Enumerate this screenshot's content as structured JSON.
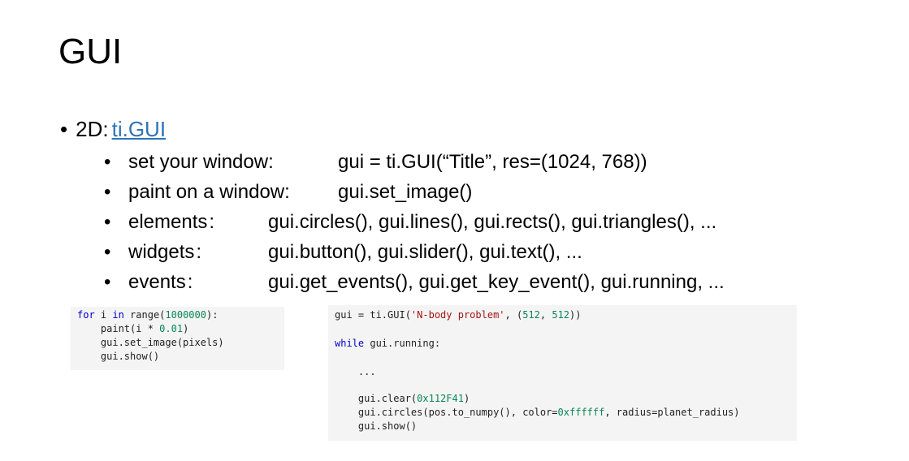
{
  "slide": {
    "title": "GUI",
    "main_bullet": {
      "prefix": "2D",
      "colon": ":",
      "link": "ti.GUI"
    },
    "items": [
      {
        "label": "set your window:",
        "value": "gui = ti.GUI(“Title”, res=(1024, 768))"
      },
      {
        "label": "paint on a window:",
        "value": "gui.set_image()"
      },
      {
        "label": "elements",
        "colon": ":",
        "value": "gui.circles(), gui.lines(), gui.rects(), gui.triangles(), ..."
      },
      {
        "label": "widgets",
        "colon": ":",
        "value": "gui.button(), gui.slider(), gui.text(), ..."
      },
      {
        "label": "events",
        "colon": ":",
        "value": "gui.get_events(), gui.get_key_event(), gui.running, ..."
      }
    ]
  },
  "code_left": {
    "l1a": "for",
    "l1b": " i ",
    "l1c": "in",
    "l1d": " range(",
    "l1e": "1000000",
    "l1f": "):",
    "l2a": "    paint(i * ",
    "l2b": "0.01",
    "l2c": ")",
    "l3": "    gui.set_image(pixels)",
    "l4": "    gui.show()"
  },
  "code_right": {
    "l1a": "gui = ti.GUI(",
    "l1b": "'N-body problem'",
    "l1c": ", (",
    "l1d": "512",
    "l1e": ", ",
    "l1f": "512",
    "l1g": "))",
    "l2a": "while",
    "l2b": " gui.running:",
    "l3": "    ...",
    "l4a": "    gui.clear(",
    "l4b": "0x112F41",
    "l4c": ")",
    "l5a": "    gui.circles(pos.to_numpy(), color=",
    "l5b": "0xffffff",
    "l5c": ", radius=planet_radius)",
    "l6": "    gui.show()"
  }
}
